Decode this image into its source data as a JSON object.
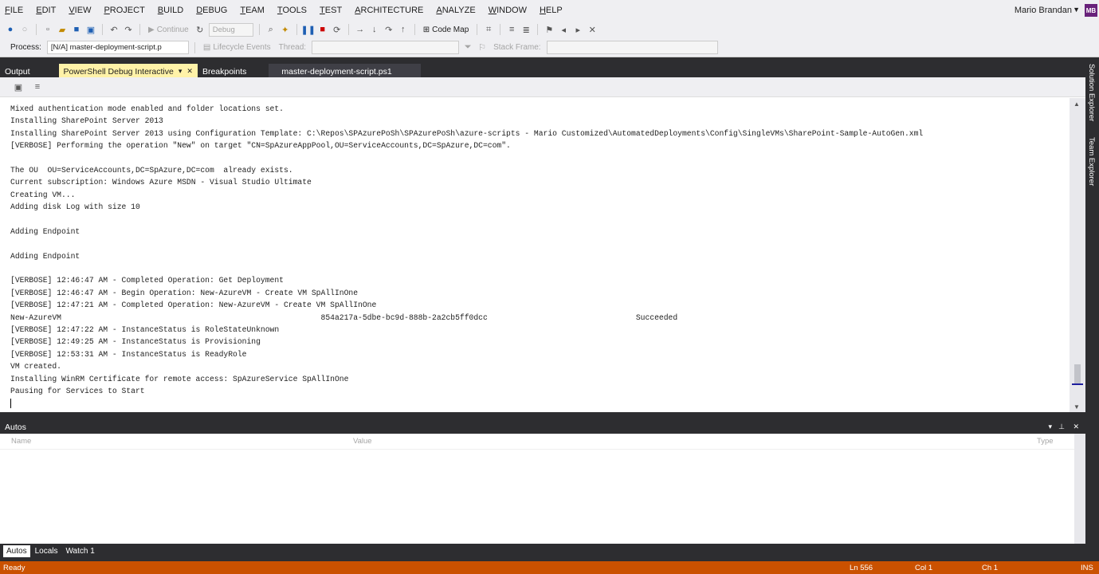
{
  "menu": [
    "FILE",
    "EDIT",
    "VIEW",
    "PROJECT",
    "BUILD",
    "DEBUG",
    "TEAM",
    "TOOLS",
    "TEST",
    "ARCHITECTURE",
    "ANALYZE",
    "WINDOW",
    "HELP"
  ],
  "user": {
    "name": "Mario Brandan",
    "initials": "MB"
  },
  "toolbar": {
    "continue": "Continue",
    "config": "Debug",
    "code_map": "Code Map"
  },
  "toolbar2": {
    "process_label": "Process:",
    "process_value": "[N/A] master-deployment-script.p",
    "lifecycle": "Lifecycle Events",
    "thread": "Thread:",
    "stack_frame": "Stack Frame:"
  },
  "tabs": [
    "Output",
    "PowerShell Debug Interactive",
    "Breakpoints",
    "master-deployment-script.ps1"
  ],
  "console_lines": [
    "Mixed authentication mode enabled and folder locations set.",
    "Installing SharePoint Server 2013",
    "Installing SharePoint Server 2013 using Configuration Template: C:\\Repos\\SPAzurePoSh\\SPAzurePoSh\\azure-scripts - Mario Customized\\AutomatedDeployments\\Config\\SingleVMs\\SharePoint-Sample-AutoGen.xml",
    "[VERBOSE] Performing the operation \"New\" on target \"CN=SpAzureAppPool,OU=ServiceAccounts,DC=SpAzure,DC=com\".",
    "",
    "The OU  OU=ServiceAccounts,DC=SpAzure,DC=com  already exists.",
    "Current subscription: Windows Azure MSDN - Visual Studio Ultimate",
    "Creating VM...",
    "Adding disk Log with size 10",
    "",
    "Adding Endpoint",
    "",
    "Adding Endpoint",
    "",
    "[VERBOSE] 12:46:47 AM - Completed Operation: Get Deployment",
    "[VERBOSE] 12:46:47 AM - Begin Operation: New-AzureVM - Create VM SpAllInOne",
    "[VERBOSE] 12:47:21 AM - Completed Operation: New-AzureVM - Create VM SpAllInOne",
    "New-AzureVM                                                        854a217a-5dbe-bc9d-888b-2a2cb5ff0dcc                                Succeeded",
    "[VERBOSE] 12:47:22 AM - InstanceStatus is RoleStateUnknown",
    "[VERBOSE] 12:49:25 AM - InstanceStatus is Provisioning",
    "[VERBOSE] 12:53:31 AM - InstanceStatus is ReadyRole",
    "VM created.",
    "Installing WinRM Certificate for remote access: SpAzureService SpAllInOne",
    "Pausing for Services to Start"
  ],
  "side_tabs": [
    "Solution Explorer",
    "Team Explorer"
  ],
  "autos": {
    "title": "Autos",
    "columns": [
      "Name",
      "Value",
      "Type"
    ]
  },
  "bottom_tabs": [
    "Autos",
    "Locals",
    "Watch 1"
  ],
  "status": {
    "ready": "Ready",
    "ln": "Ln 556",
    "col": "Col 1",
    "ch": "Ch 1",
    "ins": "INS"
  },
  "colors": {
    "accent": "#68217a",
    "status_bar": "#ca5100",
    "active_tab": "#fff2a8",
    "chrome": "#2d2d30"
  }
}
